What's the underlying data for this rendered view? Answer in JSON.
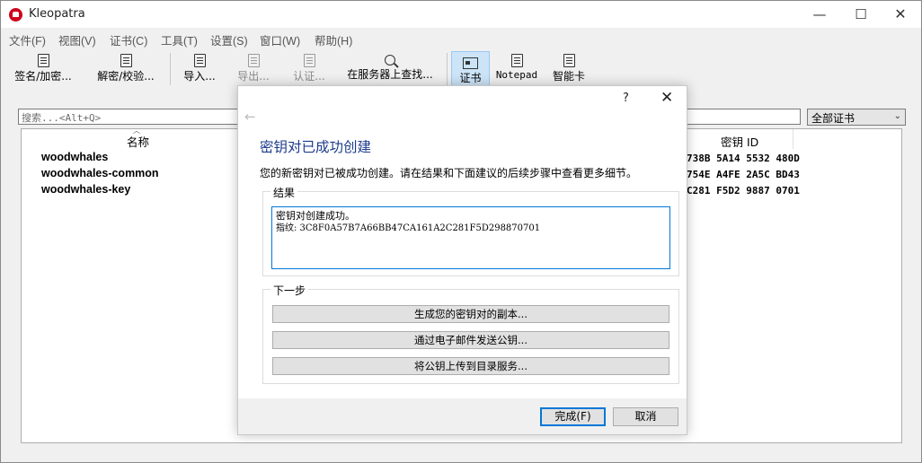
{
  "window": {
    "title": "Kleopatra"
  },
  "window_controls": {
    "minimize": "—",
    "maximize": "☐",
    "close": "✕"
  },
  "menubar": [
    "文件(F)",
    "视图(V)",
    "证书(C)",
    "工具(T)",
    "设置(S)",
    "窗口(W)",
    "帮助(H)"
  ],
  "toolbar": {
    "sign_encrypt": "签名/加密...",
    "decrypt_verify": "解密/校验...",
    "import": "导入...",
    "export": "导出...",
    "certify": "认证...",
    "lookup_server": "在服务器上查找...",
    "certificates": "证书",
    "notepad": "Notepad",
    "smartcard": "智能卡"
  },
  "search": {
    "placeholder": "搜索...<Alt+Q>"
  },
  "filter": {
    "selected": "全部证书"
  },
  "keylist": {
    "col_name": "名称",
    "col_keyid": "密钥 ID",
    "rows": [
      {
        "name": "woodwhales",
        "keyid": "738B 5A14 5532 480D"
      },
      {
        "name": "woodwhales-common",
        "keyid": "754E A4FE 2A5C BD43"
      },
      {
        "name": "woodwhales-key",
        "keyid": "C281 F5D2 9887 0701"
      }
    ]
  },
  "dialog": {
    "help": "?",
    "close": "✕",
    "back": "←",
    "heading": "密钥对已成功创建",
    "description": "您的新密钥对已被成功创建。请在结果和下面建议的后续步骤中查看更多细节。",
    "results_title": "结果",
    "result_line1": "密钥对创建成功。",
    "result_line2": "指纹: 3C8F0A57B7A66BB47CA161A2C281F5D298870701",
    "next_title": "下一步",
    "actions": [
      "生成您的密钥对的副本...",
      "通过电子邮件发送公钥...",
      "将公钥上传到目录服务..."
    ],
    "finish": "完成(F)",
    "cancel": "取消"
  }
}
